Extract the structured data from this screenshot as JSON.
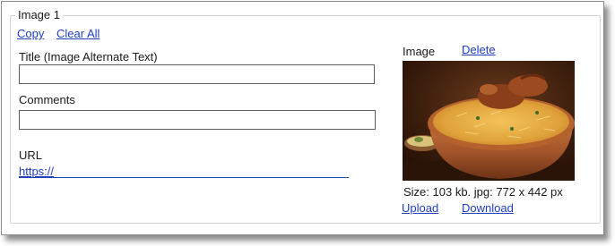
{
  "group": {
    "title": "Image 1"
  },
  "actions": {
    "copy": "Copy",
    "clear_all": "Clear All"
  },
  "fields": {
    "title_label": "Title (Image Alternate Text)",
    "title_value": "",
    "comments_label": "Comments",
    "comments_value": "",
    "url_label": "URL",
    "url_value": "https://"
  },
  "image_panel": {
    "label": "Image",
    "delete": "Delete",
    "size_info": "Size: 103 kb. jpg: 772 x 442 px",
    "upload": "Upload",
    "download": "Download"
  }
}
